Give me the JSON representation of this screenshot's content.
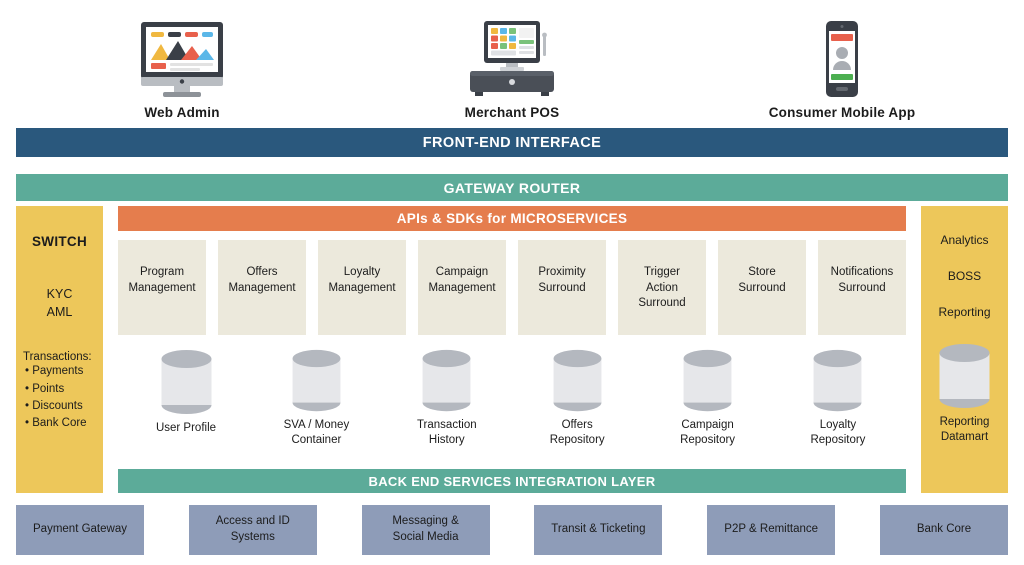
{
  "devices": [
    {
      "label": "Web Admin",
      "icon": "desktop-monitor-icon"
    },
    {
      "label": "Merchant POS",
      "icon": "pos-terminal-icon"
    },
    {
      "label": "Consumer Mobile App",
      "icon": "mobile-phone-icon"
    }
  ],
  "bars": {
    "frontend": "FRONT-END INTERFACE",
    "gateway": "GATEWAY ROUTER",
    "api": "APIs & SDKs for MICROSERVICES",
    "backend": "BACK END SERVICES INTEGRATION LAYER"
  },
  "switch_panel": {
    "title": "SWITCH",
    "kyc": "KYC",
    "aml": "AML",
    "transactions_title": "Transactions:",
    "transactions": [
      "Payments",
      "Points",
      "Discounts",
      "Bank Core"
    ]
  },
  "analytics_panel": {
    "items": [
      "Analytics",
      "BOSS",
      "Reporting"
    ],
    "datamart_label": "Reporting\nDatamart",
    "datamart_line1": "Reporting",
    "datamart_line2": "Datamart",
    "icon": "database-cylinder-icon"
  },
  "microservices": [
    {
      "line1": "Program",
      "line2": "Management"
    },
    {
      "line1": "Offers",
      "line2": "Management"
    },
    {
      "line1": "Loyalty",
      "line2": "Management"
    },
    {
      "line1": "Campaign",
      "line2": "Management"
    },
    {
      "line1": "Proximity",
      "line2": "Surround"
    },
    {
      "line1": "Trigger",
      "line2": "Action",
      "line3": "Surround"
    },
    {
      "line1": "Store",
      "line2": "Surround"
    },
    {
      "line1": "Notifications",
      "line2": "Surround"
    }
  ],
  "databases": [
    {
      "line1": "User Profile",
      "line2": ""
    },
    {
      "line1": "SVA / Money",
      "line2": "Container"
    },
    {
      "line1": "Transaction",
      "line2": "History"
    },
    {
      "line1": "Offers",
      "line2": "Repository"
    },
    {
      "line1": "Campaign",
      "line2": "Repository"
    },
    {
      "line1": "Loyalty",
      "line2": "Repository"
    }
  ],
  "external_systems": [
    {
      "line1": "Payment Gateway",
      "line2": ""
    },
    {
      "line1": "Access and ID",
      "line2": "Systems"
    },
    {
      "line1": "Messaging &",
      "line2": "Social Media"
    },
    {
      "line1": "Transit & Ticketing",
      "line2": ""
    },
    {
      "line1": "P2P & Remittance",
      "line2": ""
    },
    {
      "line1": "Bank Core",
      "line2": ""
    }
  ],
  "colors": {
    "frontend_blue": "#2a587d",
    "gateway_teal": "#5cab99",
    "api_orange": "#e57d4d",
    "switch_yellow": "#edc75a",
    "card_cream": "#ece9dc",
    "external_blue_gray": "#8e9cb8",
    "db_gray": "#b4b8bf"
  }
}
